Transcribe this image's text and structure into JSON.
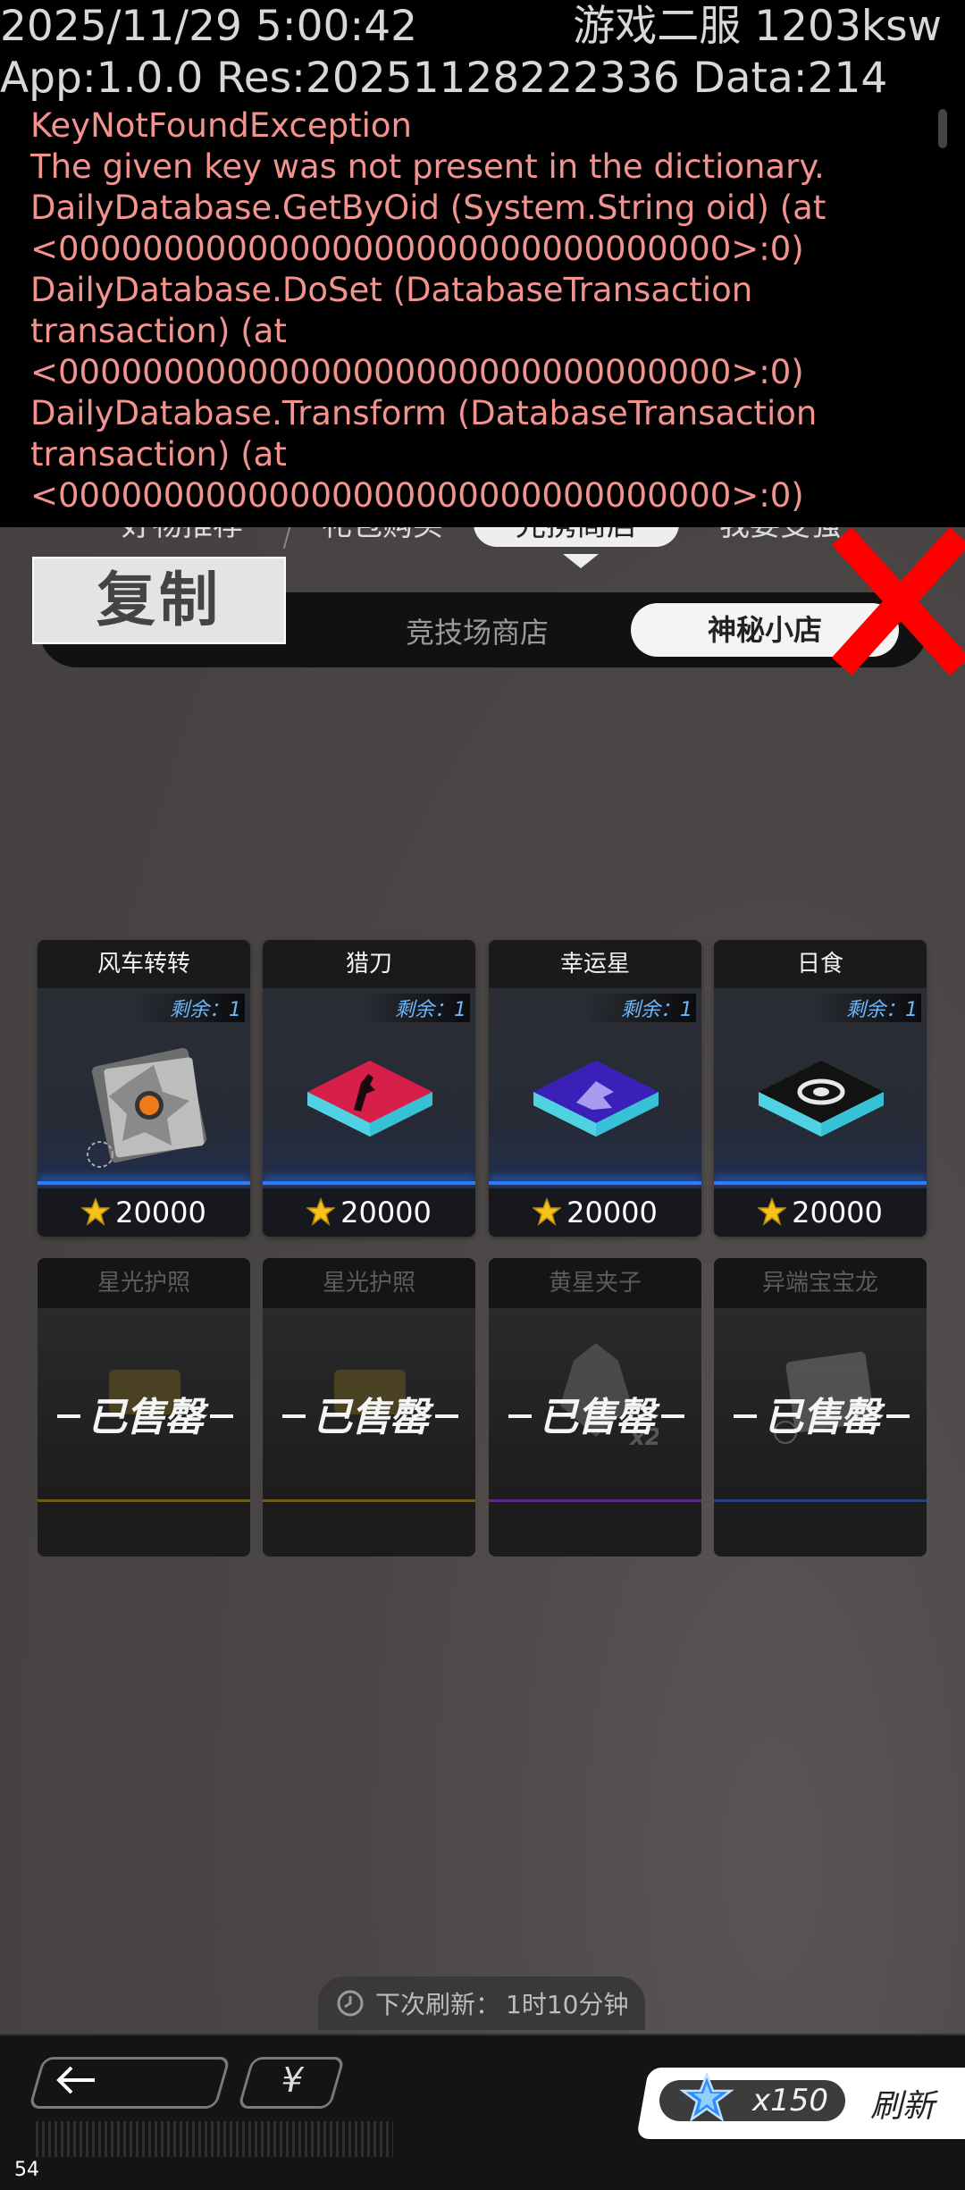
{
  "debug": {
    "timestamp": "2025/11/29 5:00:42",
    "server": "游戏二服 1203ksw",
    "app_info": "App:1.0.0 Res:20251128222336 Data:214",
    "error_lines": [
      "KeyNotFoundException",
      "The given key was not present in the dictionary.",
      "DailyDatabase.GetByOid (System.String oid) (at",
      "<00000000000000000000000000000000>:0)",
      "DailyDatabase.DoSet (DatabaseTransaction",
      "transaction) (at",
      "<00000000000000000000000000000000>:0)",
      "DailyDatabase.Transform (DatabaseTransaction",
      "transaction) (at",
      "<00000000000000000000000000000000>:0)"
    ]
  },
  "copy_button": "复制",
  "top_tabs": [
    "好物推荐",
    "礼包购买",
    "光携商店",
    "我要变强"
  ],
  "sub_tabs": {
    "arena": "竞技场商店",
    "mystery": "神秘小店"
  },
  "items": [
    {
      "name": "风车转转",
      "stock": "剩余：1",
      "price": "20000",
      "icon": "windmill-icon"
    },
    {
      "name": "猎刀",
      "stock": "剩余：1",
      "price": "20000",
      "icon": "knife-icon"
    },
    {
      "name": "幸运星",
      "stock": "剩余：1",
      "price": "20000",
      "icon": "lucky-star-icon"
    },
    {
      "name": "日食",
      "stock": "剩余：1",
      "price": "20000",
      "icon": "eclipse-icon"
    }
  ],
  "sold_items": [
    {
      "name": "星光护照",
      "status": "已售罄"
    },
    {
      "name": "星光护照",
      "status": "已售罄"
    },
    {
      "name": "黄星夹子",
      "status": "已售罄"
    },
    {
      "name": "异端宝宝龙",
      "status": "已售罄"
    }
  ],
  "refresh_timer": {
    "label": "下次刷新：",
    "value": "1时10分钟"
  },
  "bottom": {
    "yen_label": "¥",
    "gem_count": "x150",
    "refresh_label": "刷新",
    "fps": "54"
  }
}
